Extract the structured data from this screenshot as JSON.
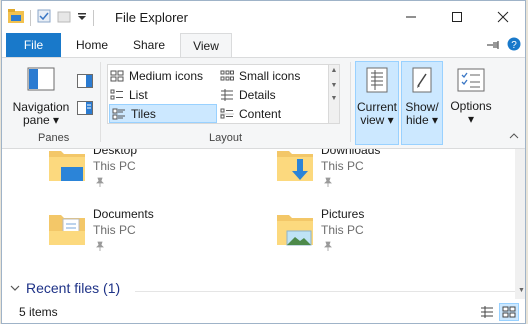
{
  "window": {
    "title": "File Explorer"
  },
  "ribbon_tabs": {
    "file": "File",
    "home": "Home",
    "share": "Share",
    "view": "View"
  },
  "panes": {
    "navigation_pane": [
      "Navigation",
      "pane ▾"
    ],
    "group_label": "Panes"
  },
  "layout": {
    "items": {
      "medium_icons": "Medium icons",
      "small_icons": "Small icons",
      "list": "List",
      "details": "Details",
      "tiles": "Tiles",
      "content": "Content"
    },
    "selected": "Tiles",
    "group_label": "Layout"
  },
  "view_buttons": {
    "current_view": [
      "Current",
      "view ▾"
    ],
    "show_hide": [
      "Show/",
      "hide ▾"
    ],
    "options": [
      "Options",
      "▾"
    ]
  },
  "folders": [
    {
      "name": "Desktop",
      "location": "This PC",
      "icon": "desktop-folder-icon"
    },
    {
      "name": "Downloads",
      "location": "This PC",
      "icon": "downloads-folder-icon"
    },
    {
      "name": "Documents",
      "location": "This PC",
      "icon": "documents-folder-icon"
    },
    {
      "name": "Pictures",
      "location": "This PC",
      "icon": "pictures-folder-icon"
    }
  ],
  "recent_files": {
    "label": "Recent files (1)"
  },
  "status": {
    "items": "5 items"
  },
  "colors": {
    "file_tab": "#1979ca",
    "selection": "#cce8ff",
    "section_heading": "#1e3287"
  }
}
